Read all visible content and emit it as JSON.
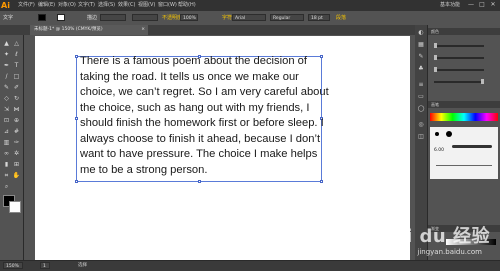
{
  "app": {
    "logo": "Ai"
  },
  "menubar": {
    "items": [
      "文件(F)",
      "编辑(E)",
      "对象(O)",
      "文字(T)",
      "选择(S)",
      "效果(C)",
      "视图(V)",
      "窗口(W)",
      "帮助(H)"
    ],
    "workspace": "基本功能",
    "window_buttons": [
      "—",
      "□",
      "✕"
    ]
  },
  "controlbar": {
    "label": "文字",
    "stroke_label": "描边",
    "opacity_label": "不透明度",
    "opacity_value": "100%",
    "char_label": "字符",
    "font_value": "Arial",
    "style_value": "Regular",
    "size_value": "18 pt",
    "paragraph_label": "段落"
  },
  "document": {
    "tab_label": "未标题-1* @ 150% (CMYK/预览)",
    "close_label": "×"
  },
  "body_text": "There is a famous poem about the decision of taking the road. It tells us once we make our choice, we can’t regret. So I am very careful about the choice, such as hang out with my friends, I should finish the homework first or before sleep. I always choose to finish it ahead, because I don’t want to have pressure. The choice I make helps me to be a strong person.",
  "tools": [
    "select-icon",
    "direct-select-icon",
    "magic-wand-icon",
    "lasso-icon",
    "pen-icon",
    "type-icon",
    "line-icon",
    "rectangle-icon",
    "paintbrush-icon",
    "pencil-icon",
    "eraser-icon",
    "rotate-icon",
    "scale-icon",
    "width-icon",
    "free-transform-icon",
    "shape-builder-icon",
    "perspective-icon",
    "mesh-icon",
    "gradient-icon",
    "eyedropper-icon",
    "blend-icon",
    "symbol-sprayer-icon",
    "graph-icon",
    "artboard-icon",
    "slice-icon",
    "hand-icon",
    "zoom-icon"
  ],
  "panels": {
    "color_title": "颜色",
    "brush_title": "画笔",
    "brush_size": "6.00",
    "gradient_title": "渐变"
  },
  "statusbar": {
    "zoom": "150%",
    "page": "1",
    "mode": "选择"
  },
  "watermark": {
    "logo": "Bai du 经验",
    "url": "jingyan.baidu.com"
  }
}
